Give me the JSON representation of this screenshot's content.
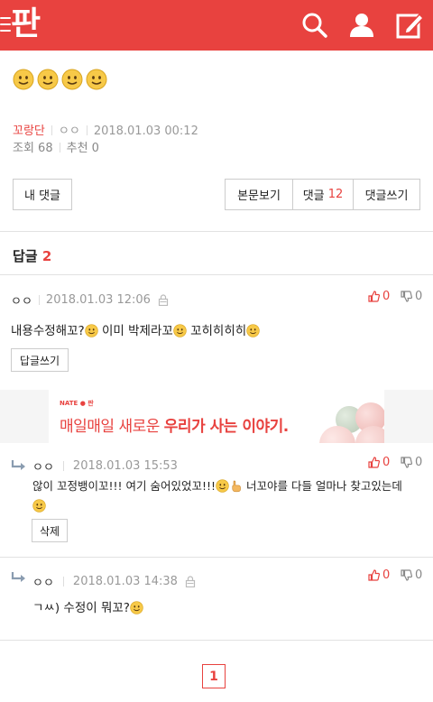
{
  "header": {
    "logo": "판",
    "icons": [
      "menu-icon",
      "search-icon",
      "user-icon",
      "write-icon"
    ],
    "brand_color": "#e8423f"
  },
  "post": {
    "title_emoji_count": 4,
    "author": "꼬랑단",
    "nickname": "ㅇㅇ",
    "date": "2018.01.03 00:12",
    "views_label": "조회 68",
    "recommend_label": "추천 0"
  },
  "buttons": {
    "my_comments": "내 댓글",
    "view_post": "본문보기",
    "comments_label": "댓글",
    "comments_count": "12",
    "write_comment": "댓글쓰기"
  },
  "replies": {
    "title": "답글",
    "count": "2"
  },
  "comments": [
    {
      "nick": "ㅇㅇ",
      "date": "2018.01.03 12:06",
      "text_a": "내용수정해꼬?",
      "text_b": " 이미 박제라꼬",
      "text_c": " 꼬히히히히",
      "up": "0",
      "down": "0",
      "action": "답글쓰기"
    },
    {
      "nick": "ㅇㅇ",
      "date": "2018.01.03 15:53",
      "text_a": "않이 꼬정뱅이꼬!!! 여기 숨어있었꼬!!!",
      "text_b": " 너꼬야를 다들 얼마나 찾고있는데",
      "up": "0",
      "down": "0",
      "action": "삭제"
    },
    {
      "nick": "ㅇㅇ",
      "date": "2018.01.03 14:38",
      "text_a": "ㄱㅆ) 수정이 뭐꼬?",
      "up": "0",
      "down": "0"
    }
  ],
  "ad": {
    "brand": "NATE ● 판",
    "text_plain": "매일매일 새로운 ",
    "text_bold": "우리가 사는 이야기."
  },
  "pagination": {
    "current": "1"
  }
}
